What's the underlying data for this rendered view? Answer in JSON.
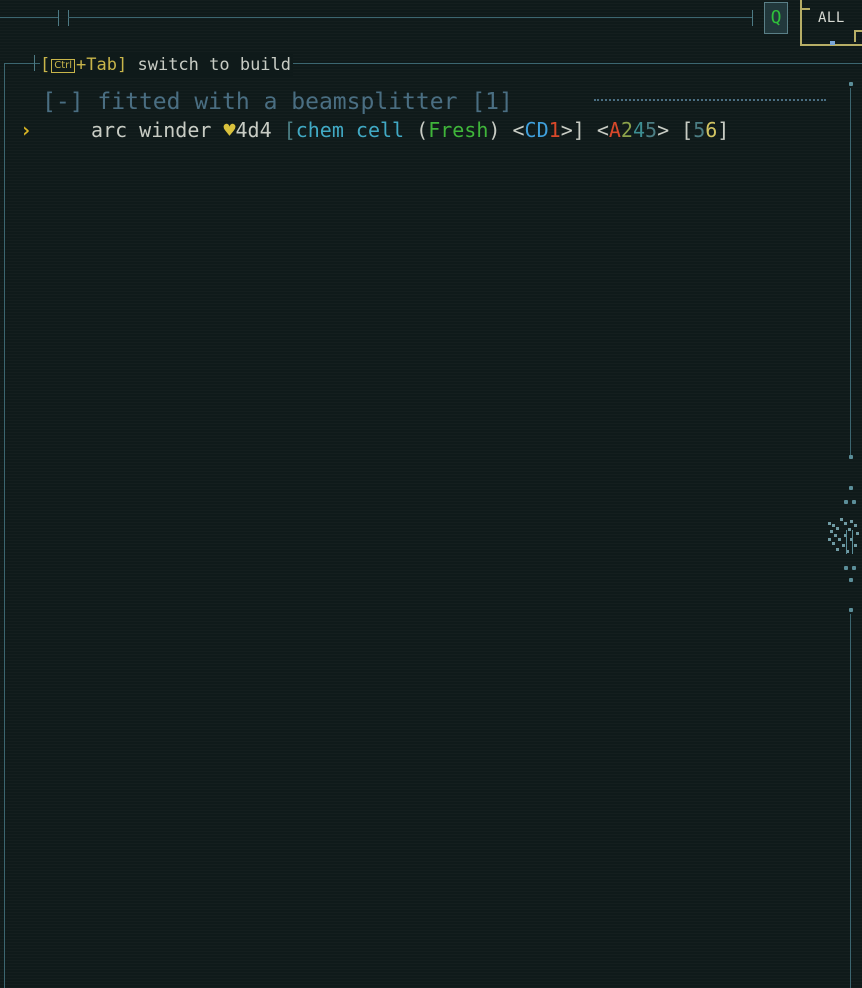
{
  "toolbar": {
    "search_label": "Q",
    "filter_tab_label": "ALL"
  },
  "hint": {
    "open_bracket": "[",
    "key": "Ctrl",
    "plus_key": "+Tab",
    "close_bracket": "]",
    "text": " switch to build"
  },
  "group": {
    "toggle": "[-]",
    "title": "fitted with a beamsplitter",
    "count": "[1]"
  },
  "item": {
    "cursor": "›",
    "name": "arc winder ",
    "heart": "♥",
    "durability": "4d4",
    "open_bracket": " [",
    "ammo": "chem cell",
    "paren_open": " (",
    "state": "Fresh",
    "paren_close": ")",
    "tag1_open": " <",
    "tag1_a": "CD",
    "tag1_b": "1",
    "tag1_close": ">]",
    "tag2_open": " <",
    "tag2_a": "A",
    "tag2_b": "2",
    "tag2_c": "4",
    "tag2_d": "5",
    "tag2_close": ">",
    "tag3_open": " [",
    "tag3_a": "5",
    "tag3_b": "6",
    "tag3_close": "]"
  },
  "colors": {
    "accent_yellow": "#c8b54a",
    "ammo_cyan": "#41a9c4",
    "fresh_green": "#3fb53a",
    "header_blue": "#4a6e82",
    "background": "#0f1a1a"
  }
}
